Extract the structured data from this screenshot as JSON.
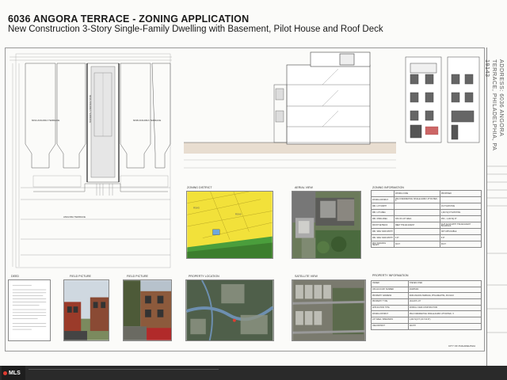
{
  "title": {
    "main": "6036 ANGORA TERRACE - ZONING APPLICATION",
    "sub": "New Construction 3-Story Single-Family Dwelling with Basement, Pilot House and Roof Deck"
  },
  "address_block": "ADDRESS: 6036 ANGORA TERRACE, PHILADELPHIA, PA 19143",
  "panels": {
    "zoning_district": "ZONING DISTRICT",
    "aerial_view": "AERIAL VIEW",
    "zoning_information": "ZONING INFORMATION",
    "deed": "DEED",
    "field_picture_1": "FIELD PICTURE",
    "field_picture_2": "FIELD PICTURE",
    "property_location": "PROPERTY LOCATION",
    "satellite_view": "SATELLITE VIEW",
    "property_information": "PROPERTY INFORMATION"
  },
  "zoning_table": {
    "headers": [
      "",
      "ZONING CODE",
      "PROPOSED"
    ],
    "rows": [
      [
        "ZONING DISTRICT",
        "RSA-5 RESIDENTIAL SINGLE-FAMILY ATTACHED - 5",
        ""
      ],
      [
        "MIN. LOT WIDTH",
        "",
        "16 FT EXISTING"
      ],
      [
        "MIN. LOT AREA",
        "",
        "1,440 SQ FT EXISTING"
      ],
      [
        "MIN. OPEN AREA",
        "30% OF LOT AREA",
        "25% - 1,100 SQ FT"
      ],
      [
        "FRONT SETBACK",
        "MEET THE ADJACENT",
        "FLAT ALIGN WITH THE ADJACENT BUILDINGS"
      ],
      [
        "MIN. SIDE YARD WIDTH",
        "",
        "NOT APPLICABLE"
      ],
      [
        "MIN. SIDE YARD WIDTH",
        "8 FT",
        "8 FT"
      ],
      [
        "MAX. BUILDING HEIGHT",
        "38 FT",
        "38 FT"
      ]
    ]
  },
  "property_table": {
    "rows": [
      [
        "OWNER",
        "STEVEN CHEN"
      ],
      [
        "OPA ACCOUNT NUMBER",
        "034055400"
      ],
      [
        "PROPERTY ADDRESS",
        "6036 ANGORA TERRACE, PHILADELPHIA, PA 19143"
      ],
      [
        "PROPERTY TYPE",
        "VACANT LOT"
      ],
      [
        "APPLICATION TYPE",
        "ZONING / NEW CONSTRUCTION"
      ],
      [
        "ZONING DISTRICT",
        "RSA-5 RESIDENTIAL SINGLE-FAMILY ATTACHED - 5"
      ],
      [
        "LOT AREA / DIMENSION",
        "1,440 SQ FT (16 X 90 FT)"
      ],
      [
        "USE DISTRICT",
        "SOUTH"
      ]
    ]
  },
  "city_label": "CITY OF PHILADELPHIA",
  "plan_labels": {
    "neighbor": "6034 ANGORA TERRACE",
    "subject": "6036 ANGORA TERRACE",
    "neighbor2": "6038 ANGORA TERRACE",
    "street": "ANGORA TERRACE"
  },
  "watermark": "MLS",
  "colors": {
    "yellow_zone": "#f2e13a",
    "green_zone": "#4a9e3c",
    "footer": "#2a2a2a",
    "mls_red": "#e03c31"
  }
}
